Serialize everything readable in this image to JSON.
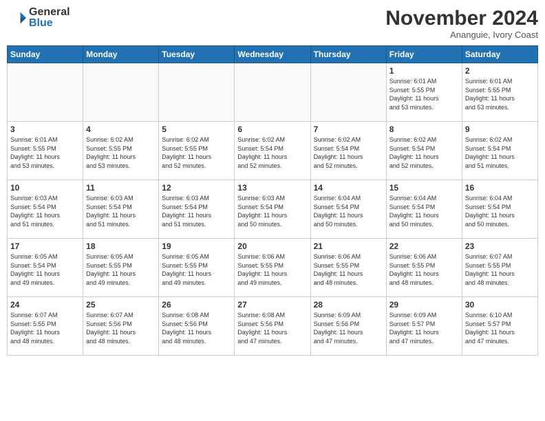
{
  "logo": {
    "general": "General",
    "blue": "Blue"
  },
  "header": {
    "month": "November 2024",
    "location": "Ananguie, Ivory Coast"
  },
  "weekdays": [
    "Sunday",
    "Monday",
    "Tuesday",
    "Wednesday",
    "Thursday",
    "Friday",
    "Saturday"
  ],
  "weeks": [
    [
      {
        "day": "",
        "info": ""
      },
      {
        "day": "",
        "info": ""
      },
      {
        "day": "",
        "info": ""
      },
      {
        "day": "",
        "info": ""
      },
      {
        "day": "",
        "info": ""
      },
      {
        "day": "1",
        "info": "Sunrise: 6:01 AM\nSunset: 5:55 PM\nDaylight: 11 hours\nand 53 minutes."
      },
      {
        "day": "2",
        "info": "Sunrise: 6:01 AM\nSunset: 5:55 PM\nDaylight: 11 hours\nand 53 minutes."
      }
    ],
    [
      {
        "day": "3",
        "info": "Sunrise: 6:01 AM\nSunset: 5:55 PM\nDaylight: 11 hours\nand 53 minutes."
      },
      {
        "day": "4",
        "info": "Sunrise: 6:02 AM\nSunset: 5:55 PM\nDaylight: 11 hours\nand 53 minutes."
      },
      {
        "day": "5",
        "info": "Sunrise: 6:02 AM\nSunset: 5:55 PM\nDaylight: 11 hours\nand 52 minutes."
      },
      {
        "day": "6",
        "info": "Sunrise: 6:02 AM\nSunset: 5:54 PM\nDaylight: 11 hours\nand 52 minutes."
      },
      {
        "day": "7",
        "info": "Sunrise: 6:02 AM\nSunset: 5:54 PM\nDaylight: 11 hours\nand 52 minutes."
      },
      {
        "day": "8",
        "info": "Sunrise: 6:02 AM\nSunset: 5:54 PM\nDaylight: 11 hours\nand 52 minutes."
      },
      {
        "day": "9",
        "info": "Sunrise: 6:02 AM\nSunset: 5:54 PM\nDaylight: 11 hours\nand 51 minutes."
      }
    ],
    [
      {
        "day": "10",
        "info": "Sunrise: 6:03 AM\nSunset: 5:54 PM\nDaylight: 11 hours\nand 51 minutes."
      },
      {
        "day": "11",
        "info": "Sunrise: 6:03 AM\nSunset: 5:54 PM\nDaylight: 11 hours\nand 51 minutes."
      },
      {
        "day": "12",
        "info": "Sunrise: 6:03 AM\nSunset: 5:54 PM\nDaylight: 11 hours\nand 51 minutes."
      },
      {
        "day": "13",
        "info": "Sunrise: 6:03 AM\nSunset: 5:54 PM\nDaylight: 11 hours\nand 50 minutes."
      },
      {
        "day": "14",
        "info": "Sunrise: 6:04 AM\nSunset: 5:54 PM\nDaylight: 11 hours\nand 50 minutes."
      },
      {
        "day": "15",
        "info": "Sunrise: 6:04 AM\nSunset: 5:54 PM\nDaylight: 11 hours\nand 50 minutes."
      },
      {
        "day": "16",
        "info": "Sunrise: 6:04 AM\nSunset: 5:54 PM\nDaylight: 11 hours\nand 50 minutes."
      }
    ],
    [
      {
        "day": "17",
        "info": "Sunrise: 6:05 AM\nSunset: 5:54 PM\nDaylight: 11 hours\nand 49 minutes."
      },
      {
        "day": "18",
        "info": "Sunrise: 6:05 AM\nSunset: 5:55 PM\nDaylight: 11 hours\nand 49 minutes."
      },
      {
        "day": "19",
        "info": "Sunrise: 6:05 AM\nSunset: 5:55 PM\nDaylight: 11 hours\nand 49 minutes."
      },
      {
        "day": "20",
        "info": "Sunrise: 6:06 AM\nSunset: 5:55 PM\nDaylight: 11 hours\nand 49 minutes."
      },
      {
        "day": "21",
        "info": "Sunrise: 6:06 AM\nSunset: 5:55 PM\nDaylight: 11 hours\nand 48 minutes."
      },
      {
        "day": "22",
        "info": "Sunrise: 6:06 AM\nSunset: 5:55 PM\nDaylight: 11 hours\nand 48 minutes."
      },
      {
        "day": "23",
        "info": "Sunrise: 6:07 AM\nSunset: 5:55 PM\nDaylight: 11 hours\nand 48 minutes."
      }
    ],
    [
      {
        "day": "24",
        "info": "Sunrise: 6:07 AM\nSunset: 5:55 PM\nDaylight: 11 hours\nand 48 minutes."
      },
      {
        "day": "25",
        "info": "Sunrise: 6:07 AM\nSunset: 5:56 PM\nDaylight: 11 hours\nand 48 minutes."
      },
      {
        "day": "26",
        "info": "Sunrise: 6:08 AM\nSunset: 5:56 PM\nDaylight: 11 hours\nand 48 minutes."
      },
      {
        "day": "27",
        "info": "Sunrise: 6:08 AM\nSunset: 5:56 PM\nDaylight: 11 hours\nand 47 minutes."
      },
      {
        "day": "28",
        "info": "Sunrise: 6:09 AM\nSunset: 5:56 PM\nDaylight: 11 hours\nand 47 minutes."
      },
      {
        "day": "29",
        "info": "Sunrise: 6:09 AM\nSunset: 5:57 PM\nDaylight: 11 hours\nand 47 minutes."
      },
      {
        "day": "30",
        "info": "Sunrise: 6:10 AM\nSunset: 5:57 PM\nDaylight: 11 hours\nand 47 minutes."
      }
    ]
  ]
}
